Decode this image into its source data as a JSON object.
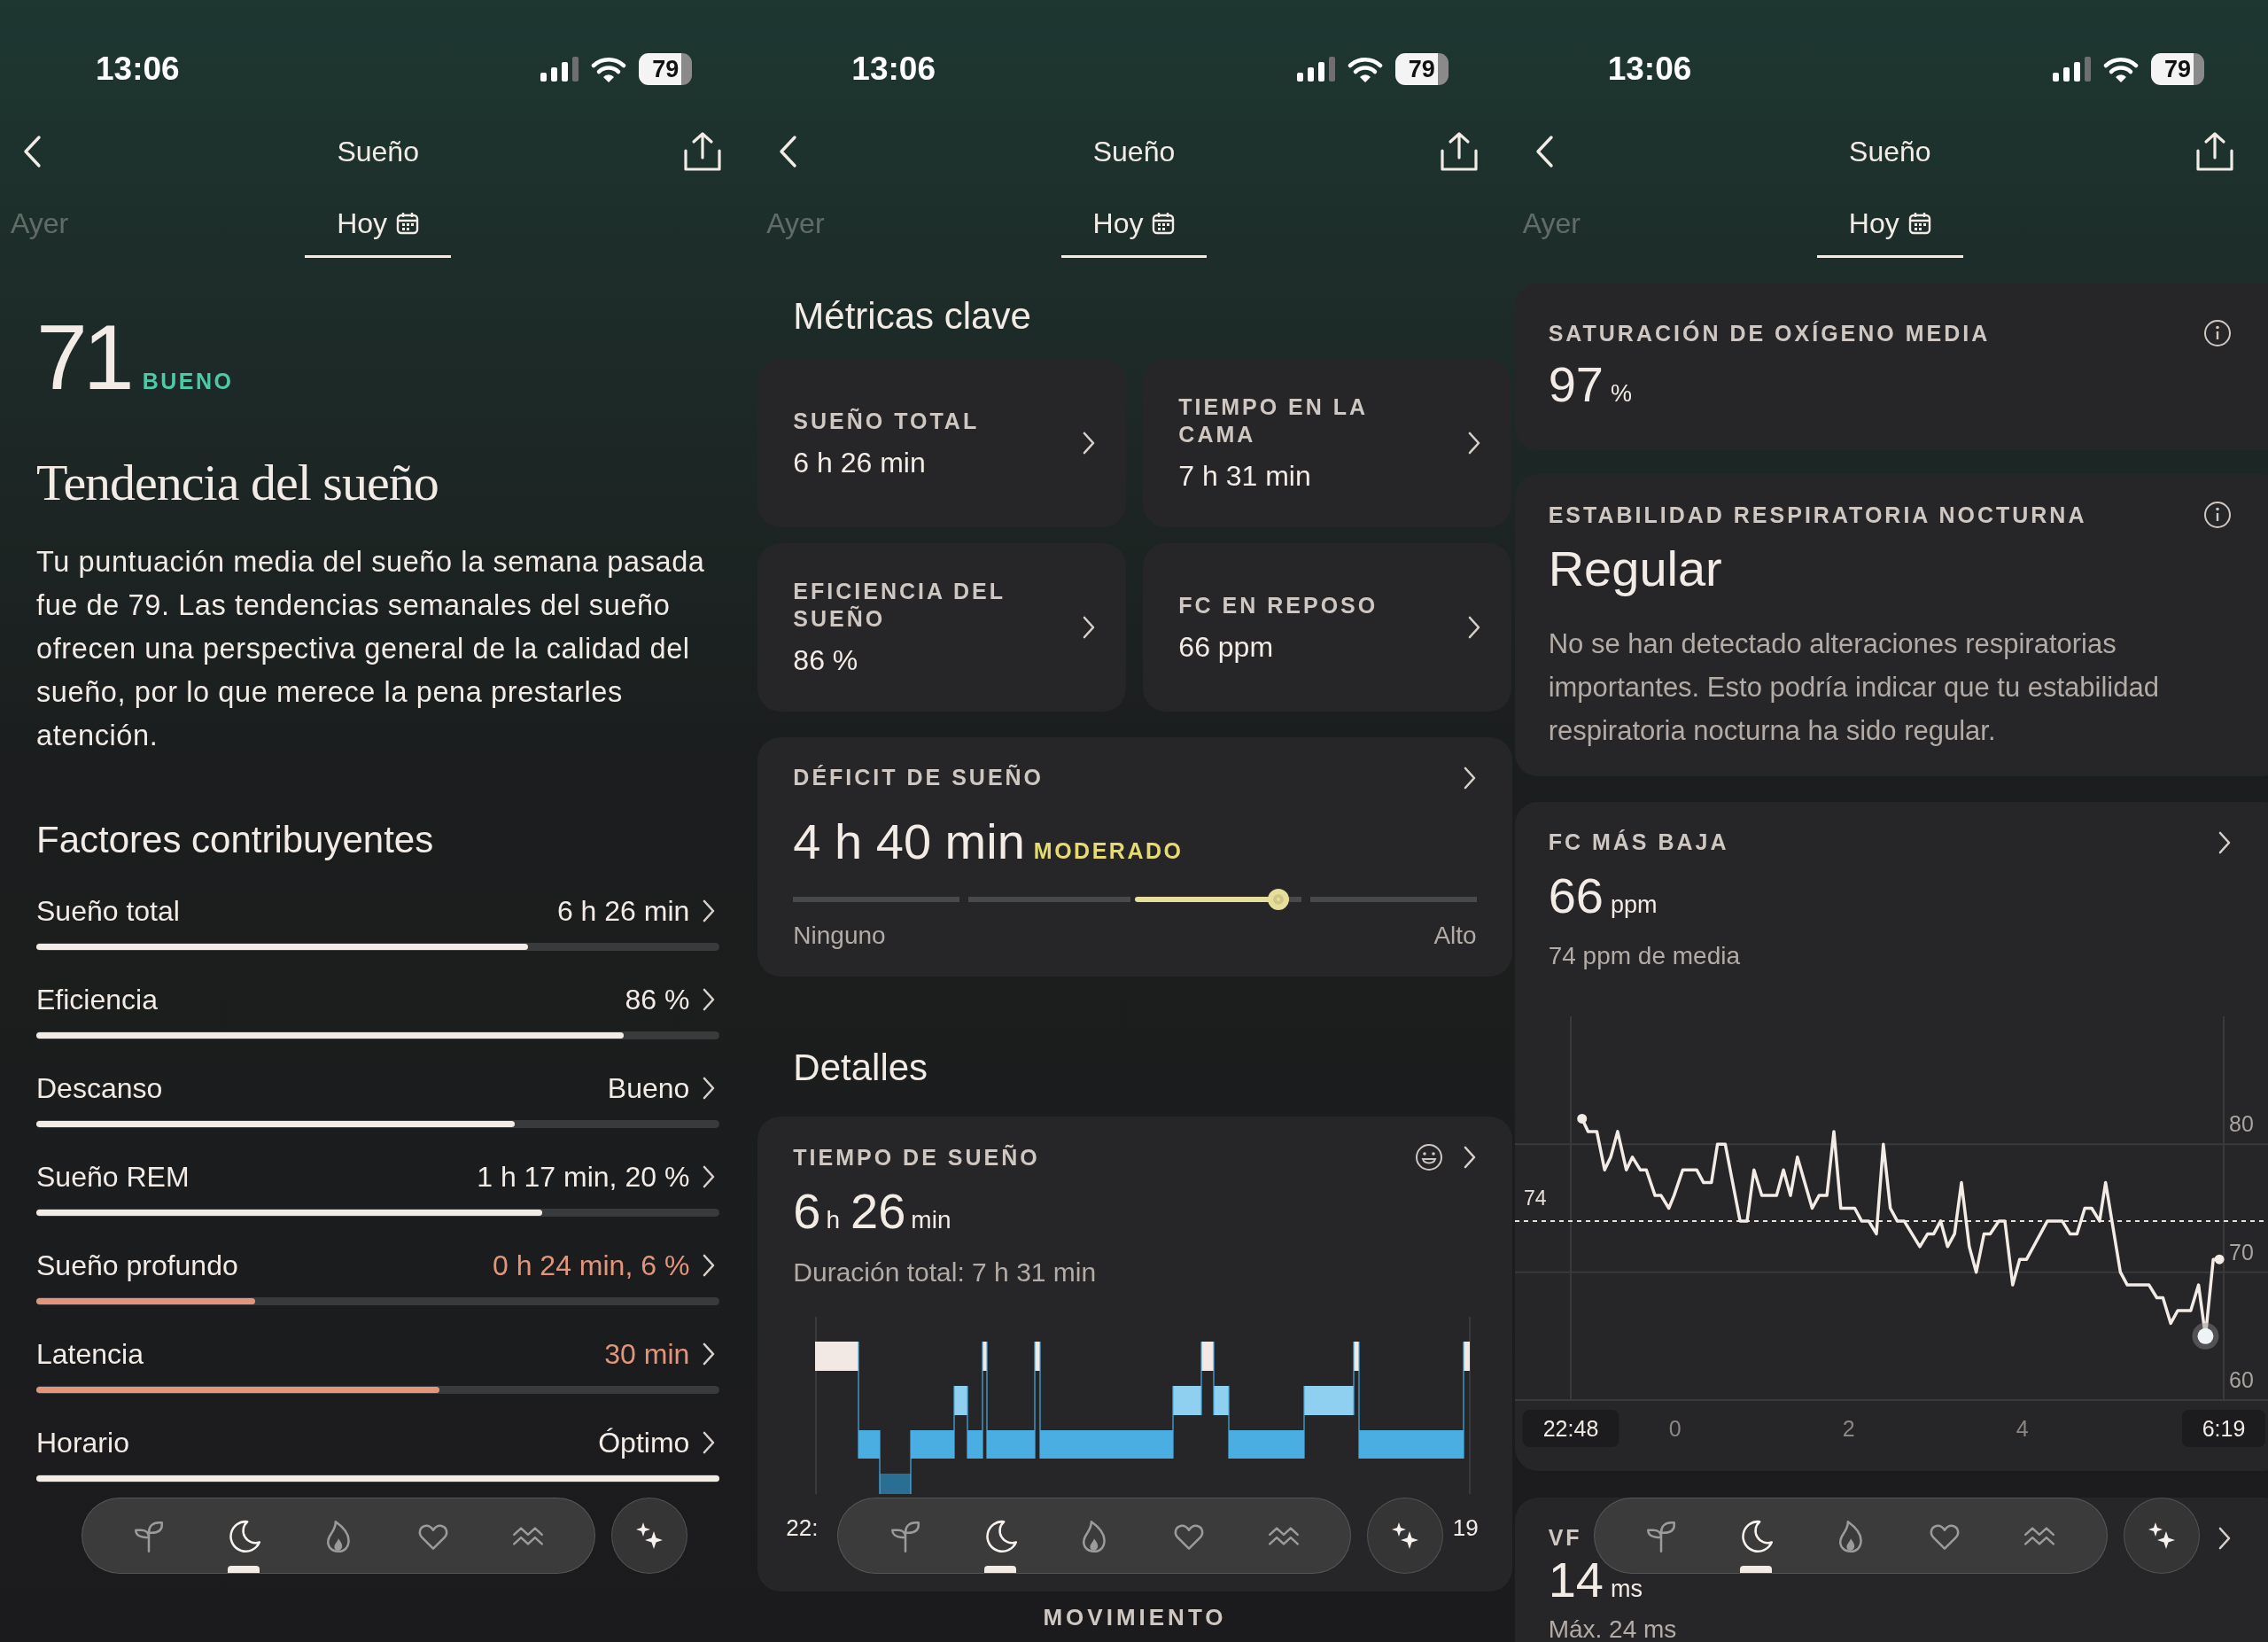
{
  "screens": [
    {
      "status": {
        "time": "13:06",
        "battery": "79"
      },
      "header": {
        "title": "Sueño",
        "tabs": [
          {
            "label": "Ayer",
            "selected": false
          },
          {
            "label": "Hoy",
            "selected": true
          }
        ]
      },
      "content": {
        "kind": "score",
        "score": "71",
        "rating": "BUENO",
        "title": "Tendencia del sueño",
        "summary": "Tu puntuación media del sueño la semana pasada fue de 79. Las tendencias semanales del sueño ofrecen una perspectiva general de la calidad del sueño, por lo que merece la pena prestarles atención.",
        "section": "Factores contribuyentes",
        "factors": [
          {
            "label": "Sueño total",
            "value": "6 h 26 min",
            "level": 0.72,
            "attention": false
          },
          {
            "label": "Eficiencia",
            "value": "86 %",
            "level": 0.86,
            "attention": false
          },
          {
            "label": "Descanso",
            "value": "Bueno",
            "level": 0.7,
            "attention": false
          },
          {
            "label": "Sueño REM",
            "value": "1 h 17 min, 20 %",
            "level": 0.74,
            "attention": false
          },
          {
            "label": "Sueño profundo",
            "value": "0 h 24 min, 6 %",
            "level": 0.32,
            "attention": true
          },
          {
            "label": "Latencia",
            "value": "30 min",
            "level": 0.59,
            "attention": true
          },
          {
            "label": "Horario",
            "value": "Óptimo",
            "level": 1.0,
            "attention": false
          }
        ]
      },
      "bottom_nav": {
        "items": [
          {
            "selected": false
          },
          {
            "selected": true
          },
          {
            "selected": false
          },
          {
            "selected": false
          },
          {
            "selected": false
          }
        ]
      }
    },
    {
      "status": {
        "time": "13:06",
        "battery": "79"
      },
      "header": {
        "title": "Sueño",
        "tabs": [
          {
            "label": "Ayer",
            "selected": false
          },
          {
            "label": "Hoy",
            "selected": true
          }
        ]
      },
      "content": {
        "kind": "metrics",
        "section": "Métricas clave",
        "metrics": [
          {
            "label": "SUEÑO TOTAL",
            "value": "6 h 26 min"
          },
          {
            "label": "TIEMPO EN LA CAMA",
            "value": "7 h 31 min"
          },
          {
            "label": "EFICIENCIA DEL SUEÑO",
            "value": "86 %"
          },
          {
            "label": "FC EN REPOSO",
            "value": "66 ppm"
          }
        ],
        "deficit": {
          "label": "DÉFICIT DE SUEÑO",
          "value": "4 h 40 min",
          "rating": "MODERADO",
          "level": 0.71,
          "min_label": "Ninguno",
          "max_label": "Alto"
        },
        "details_title": "Detalles",
        "sleep_card": {
          "label": "TIEMPO DE SUEÑO",
          "value": [
            {
              "number": "6",
              "unit": "h"
            },
            {
              "number": "26",
              "unit": "min"
            }
          ],
          "total": "Duración total: 7 h 31 min",
          "axis_start": "22:",
          "axis_end": "19"
        },
        "next_section": "MOVIMIENTO"
      },
      "bottom_nav": {
        "items": [
          {
            "selected": false
          },
          {
            "selected": true
          },
          {
            "selected": false
          },
          {
            "selected": false
          },
          {
            "selected": false
          }
        ]
      }
    },
    {
      "status": {
        "time": "13:06",
        "battery": "79"
      },
      "header": {
        "title": "Sueño",
        "tabs": [
          {
            "label": "Ayer",
            "selected": false
          },
          {
            "label": "Hoy",
            "selected": true
          }
        ]
      },
      "content": {
        "kind": "vitals",
        "cards": [
          {
            "kind": "reading",
            "label": "SATURACIÓN DE OXÍGENO MEDIA",
            "number": "97",
            "unit": "%",
            "has_info": true
          },
          {
            "kind": "status",
            "label": "ESTABILIDAD RESPIRATORIA NOCTURNA",
            "status": "Regular",
            "text": "No se han detectado alteraciones respiratorias importantes. Esto podría indicar que tu estabilidad respiratoria nocturna ha sido regular.",
            "has_info": true
          },
          {
            "kind": "chart",
            "label": "FC MÁS BAJA",
            "number": "66",
            "unit": "ppm",
            "sub": "74 ppm de media",
            "has_info": false,
            "chart_data": {
              "type": "line",
              "xlim": [
                -1.2,
                6.32
              ],
              "ylim": [
                60,
                90
              ],
              "xticks": [
                0,
                2,
                4
              ],
              "yticks": [
                60,
                70,
                80
              ],
              "ref_lines": [
                {
                  "axis": "y",
                  "value": 74,
                  "label": "74"
                }
              ],
              "annotations": [
                "22:48",
                "6:19"
              ],
              "x": [
                -1.07,
                -1.0,
                -0.9,
                -0.81,
                -0.74,
                -0.66,
                -0.56,
                -0.49,
                -0.4,
                -0.33,
                -0.23,
                -0.16,
                -0.07,
                -0.01,
                0.09,
                0.25,
                0.33,
                0.42,
                0.49,
                0.58,
                0.75,
                0.83,
                0.91,
                1.0,
                1.17,
                1.25,
                1.33,
                1.41,
                1.58,
                1.66,
                1.75,
                1.83,
                1.91,
                2.07,
                2.15,
                2.23,
                2.32,
                2.4,
                2.48,
                2.56,
                2.64,
                2.82,
                2.91,
                2.98,
                3.06,
                3.14,
                3.22,
                3.3,
                3.39,
                3.47,
                3.56,
                3.63,
                3.73,
                3.8,
                3.89,
                3.97,
                4.05,
                4.29,
                4.46,
                4.55,
                4.63,
                4.72,
                4.8,
                4.89,
                4.96,
                5.13,
                5.21,
                5.46,
                5.55,
                5.62,
                5.71,
                5.79,
                5.94,
                6.03,
                6.11,
                6.2,
                6.27
              ],
              "values": [
                82,
                81,
                81,
                78,
                79,
                81,
                78,
                79,
                78,
                78,
                76,
                76,
                75,
                76,
                78,
                78,
                77,
                77,
                80,
                80,
                74,
                74,
                78,
                76,
                76,
                78,
                76,
                79,
                75,
                76,
                76,
                81,
                75,
                75,
                74,
                74,
                73,
                80,
                75,
                74,
                74,
                72,
                73,
                73,
                74,
                72,
                73,
                77,
                72,
                70,
                73,
                73,
                74,
                74,
                69,
                71,
                71,
                74,
                74,
                73,
                73,
                75,
                75,
                74,
                77,
                70,
                69,
                69,
                68,
                68,
                66,
                67,
                67,
                69,
                65,
                71,
                71
              ]
            }
          },
          {
            "kind": "reading",
            "label": "VF",
            "number": "14",
            "unit": "ms",
            "sub": "Máx. 24 ms",
            "has_info": false
          }
        ]
      },
      "bottom_nav": {
        "items": [
          {
            "selected": false
          },
          {
            "selected": true
          },
          {
            "selected": false
          },
          {
            "selected": false
          },
          {
            "selected": false
          }
        ]
      }
    }
  ]
}
